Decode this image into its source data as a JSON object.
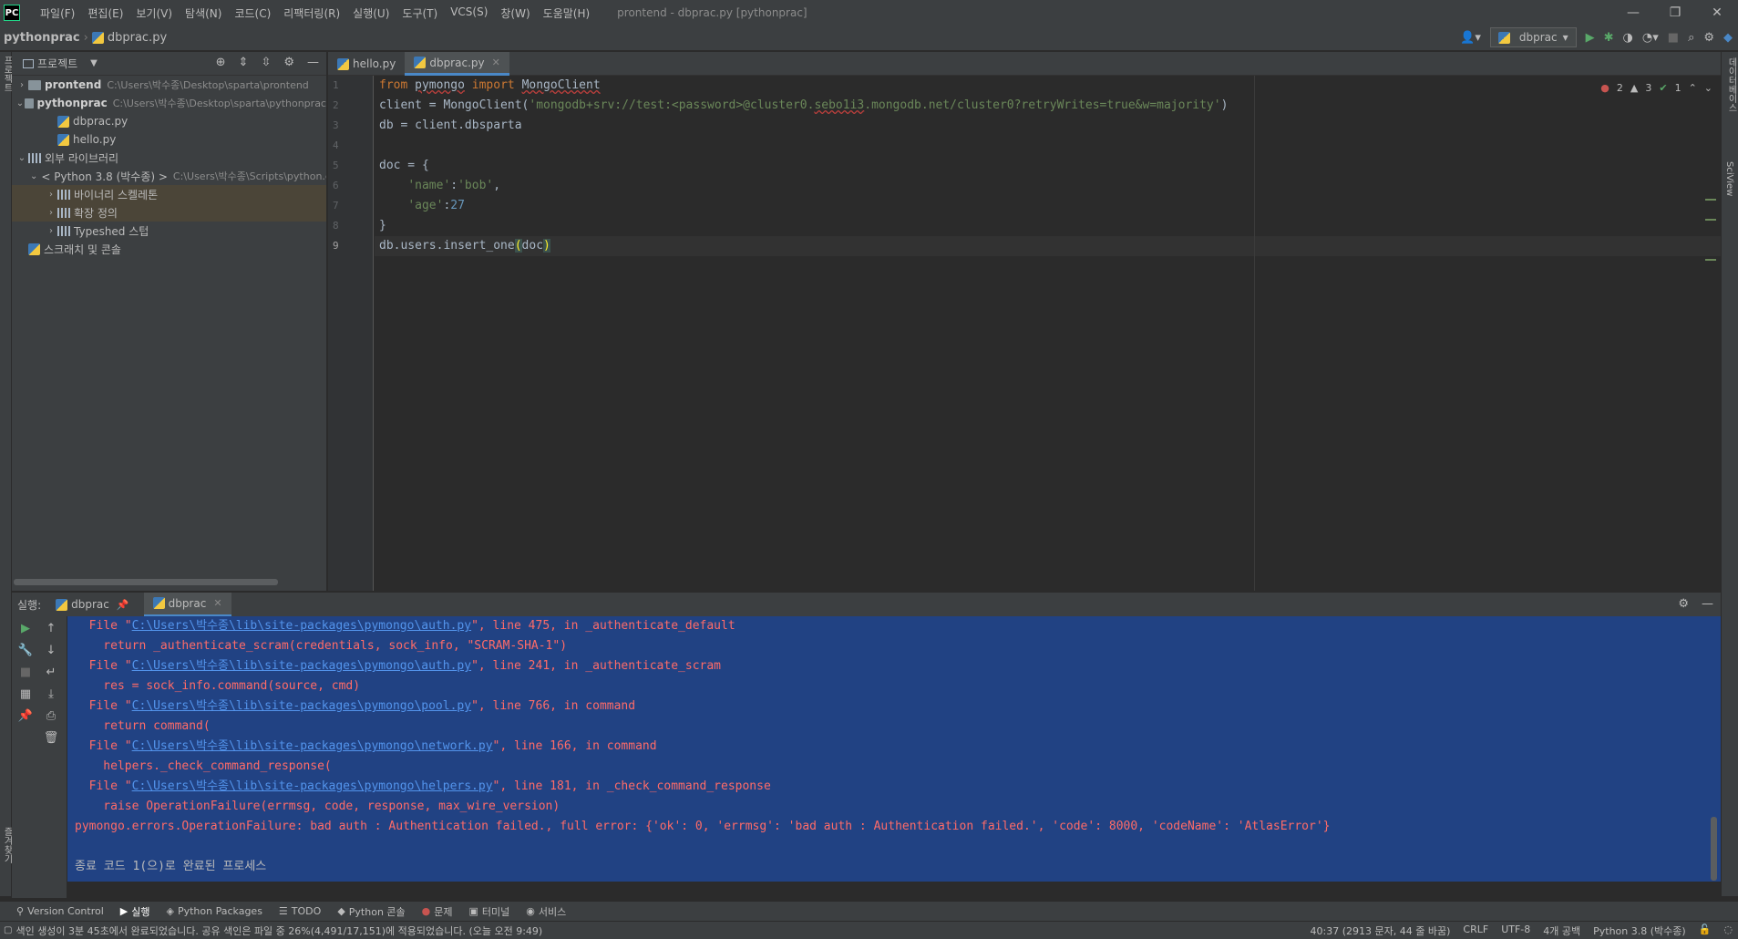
{
  "menu": {
    "logo": "PC",
    "items": [
      "파일(F)",
      "편집(E)",
      "보기(V)",
      "탐색(N)",
      "코드(C)",
      "리팩터링(R)",
      "실행(U)",
      "도구(T)",
      "VCS(S)",
      "창(W)",
      "도움말(H)"
    ],
    "window_title": "prontend - dbprac.py [pythonprac]"
  },
  "breadcrumb": {
    "root": "pythonprac",
    "file": "dbprac.py"
  },
  "run_config": {
    "name": "dbprac"
  },
  "project": {
    "title": "프로젝트",
    "tree": [
      {
        "label": "prontend",
        "path": "C:\\Users\\박수종\\Desktop\\sparta\\prontend",
        "type": "folder",
        "depth": 0,
        "chevron": "›",
        "bold": true
      },
      {
        "label": "pythonprac",
        "path": "C:\\Users\\박수종\\Desktop\\sparta\\pythonprac",
        "type": "folder",
        "depth": 0,
        "chevron": "⌄",
        "bold": true
      },
      {
        "label": "dbprac.py",
        "path": "",
        "type": "pyfile",
        "depth": 2,
        "chevron": "",
        "bold": false
      },
      {
        "label": "hello.py",
        "path": "",
        "type": "pyfile",
        "depth": 2,
        "chevron": "",
        "bold": false
      },
      {
        "label": "외부 라이브러리",
        "path": "",
        "type": "lib",
        "depth": 0,
        "chevron": "⌄",
        "bold": false
      },
      {
        "label": "< Python 3.8 (박수종) >",
        "path": "C:\\Users\\박수종\\Scripts\\python.exe",
        "type": "python",
        "depth": 1,
        "chevron": "⌄",
        "bold": false
      },
      {
        "label": "바이너리 스켈레톤",
        "path": "",
        "type": "lib",
        "depth": 2,
        "chevron": "›",
        "bold": false,
        "selected": true
      },
      {
        "label": "확장 정의",
        "path": "",
        "type": "lib",
        "depth": 2,
        "chevron": "›",
        "bold": false,
        "selected": true
      },
      {
        "label": "Typeshed 스텁",
        "path": "",
        "type": "lib",
        "depth": 2,
        "chevron": "›",
        "bold": false
      },
      {
        "label": "스크래치 및 콘솔",
        "path": "",
        "type": "scratch",
        "depth": 0,
        "chevron": "",
        "bold": false
      }
    ]
  },
  "editor": {
    "tabs": [
      {
        "label": "hello.py",
        "active": false
      },
      {
        "label": "dbprac.py",
        "active": true
      }
    ],
    "inspections": {
      "errors": "2",
      "warnings": "3",
      "ok": "1"
    },
    "line_numbers": [
      "1",
      "2",
      "3",
      "4",
      "5",
      "6",
      "7",
      "8",
      "9"
    ]
  },
  "run": {
    "label": "실행:",
    "tabs": [
      {
        "label": "dbprac",
        "active": false
      },
      {
        "label": "dbprac",
        "active": true
      }
    ],
    "console": [
      {
        "kind": "file",
        "pre": "  File \"",
        "link": "C:\\Users\\박수종\\lib\\site-packages\\pymongo\\auth.py",
        "post": "\", line 475, in _authenticate_default"
      },
      {
        "kind": "text",
        "text": "    return _authenticate_scram(credentials, sock_info, \"SCRAM-SHA-1\")"
      },
      {
        "kind": "file",
        "pre": "  File \"",
        "link": "C:\\Users\\박수종\\lib\\site-packages\\pymongo\\auth.py",
        "post": "\", line 241, in _authenticate_scram"
      },
      {
        "kind": "text",
        "text": "    res = sock_info.command(source, cmd)"
      },
      {
        "kind": "file",
        "pre": "  File \"",
        "link": "C:\\Users\\박수종\\lib\\site-packages\\pymongo\\pool.py",
        "post": "\", line 766, in command"
      },
      {
        "kind": "text",
        "text": "    return command("
      },
      {
        "kind": "file",
        "pre": "  File \"",
        "link": "C:\\Users\\박수종\\lib\\site-packages\\pymongo\\network.py",
        "post": "\", line 166, in command"
      },
      {
        "kind": "text",
        "text": "    helpers._check_command_response("
      },
      {
        "kind": "file",
        "pre": "  File \"",
        "link": "C:\\Users\\박수종\\lib\\site-packages\\pymongo\\helpers.py",
        "post": "\", line 181, in _check_command_response"
      },
      {
        "kind": "text",
        "text": "    raise OperationFailure(errmsg, code, response, max_wire_version)"
      },
      {
        "kind": "text",
        "text": "pymongo.errors.OperationFailure: bad auth : Authentication failed., full error: {'ok': 0, 'errmsg': 'bad auth : Authentication failed.', 'code': 8000, 'codeName': 'AtlasError'}"
      },
      {
        "kind": "blank",
        "text": ""
      },
      {
        "kind": "exit",
        "text": "종료 코드 1(으)로 완료된 프로세스"
      }
    ]
  },
  "bottom_tools": [
    {
      "label": "Version Control",
      "icon": "⚲",
      "active": false
    },
    {
      "label": "실행",
      "icon": "▶",
      "active": true
    },
    {
      "label": "Python Packages",
      "icon": "◈",
      "active": false
    },
    {
      "label": "TODO",
      "icon": "☰",
      "active": false
    },
    {
      "label": "Python 콘솔",
      "icon": "◆",
      "active": false
    },
    {
      "label": "문제",
      "icon": "●",
      "active": false
    },
    {
      "label": "터미널",
      "icon": "▣",
      "active": false
    },
    {
      "label": "서비스",
      "icon": "◉",
      "active": false
    }
  ],
  "status": {
    "message": "색인 생성이 3분 45초에서 완료되었습니다. 공유 색인은 파일 중 26%(4,491/17,151)에 적용되었습니다. (오늘 오전 9:49)",
    "position": "40:37 (2913 문자, 44 줄 바꿈)",
    "line_sep": "CRLF",
    "encoding": "UTF-8",
    "indent": "4개 공백",
    "interpreter": "Python 3.8 (박수종)"
  },
  "side_labels": {
    "left_top": "프로젝트",
    "left_bottom": "즐겨찾기",
    "right_top": "데이터베이스",
    "right_mid": "SciView"
  },
  "colors": {
    "accent": "#4a88c7",
    "error": "#ff6b68",
    "link": "#5394ec",
    "selection": "#214283"
  }
}
